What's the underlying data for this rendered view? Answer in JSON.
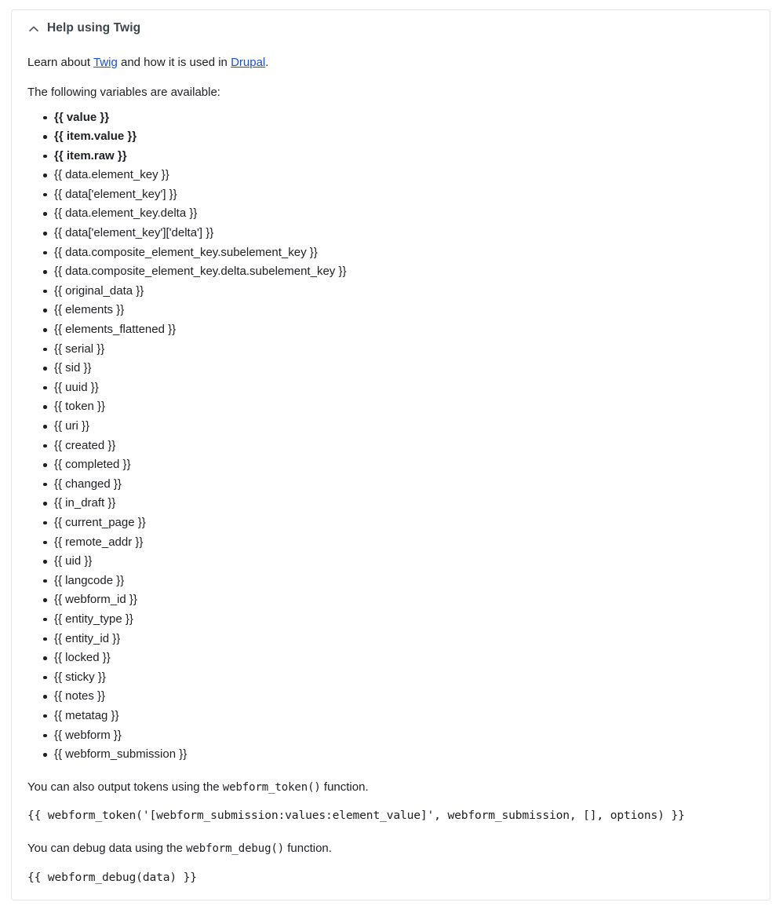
{
  "help_panel": {
    "title": "Help using Twig",
    "chevron_icon": "chevron-up-icon",
    "expanded": true,
    "intro": {
      "before_first_link": "Learn about ",
      "first_link": "Twig",
      "between_links": " and how it is used in ",
      "second_link": "Drupal",
      "after_second_link": "."
    },
    "available_heading": "The following variables are available:",
    "variables": [
      {
        "text": "{{ value }}",
        "bold": true
      },
      {
        "text": "{{ item.value }}",
        "bold": true
      },
      {
        "text": "{{ item.raw }}",
        "bold": true
      },
      {
        "text": "{{ data.element_key }}",
        "bold": false
      },
      {
        "text": "{{ data['element_key'] }}",
        "bold": false
      },
      {
        "text": "{{ data.element_key.delta }}",
        "bold": false
      },
      {
        "text": "{{ data['element_key']['delta'] }}",
        "bold": false
      },
      {
        "text": "{{ data.composite_element_key.subelement_key }}",
        "bold": false
      },
      {
        "text": "{{ data.composite_element_key.delta.subelement_key }}",
        "bold": false
      },
      {
        "text": "{{ original_data }}",
        "bold": false
      },
      {
        "text": "{{ elements }}",
        "bold": false
      },
      {
        "text": "{{ elements_flattened }}",
        "bold": false
      },
      {
        "text": "{{ serial }}",
        "bold": false
      },
      {
        "text": "{{ sid }}",
        "bold": false
      },
      {
        "text": "{{ uuid }}",
        "bold": false
      },
      {
        "text": "{{ token }}",
        "bold": false
      },
      {
        "text": "{{ uri }}",
        "bold": false
      },
      {
        "text": "{{ created }}",
        "bold": false
      },
      {
        "text": "{{ completed }}",
        "bold": false
      },
      {
        "text": "{{ changed }}",
        "bold": false
      },
      {
        "text": "{{ in_draft }}",
        "bold": false
      },
      {
        "text": "{{ current_page }}",
        "bold": false
      },
      {
        "text": "{{ remote_addr }}",
        "bold": false
      },
      {
        "text": "{{ uid }}",
        "bold": false
      },
      {
        "text": "{{ langcode }}",
        "bold": false
      },
      {
        "text": "{{ webform_id }}",
        "bold": false
      },
      {
        "text": "{{ entity_type }}",
        "bold": false
      },
      {
        "text": "{{ entity_id }}",
        "bold": false
      },
      {
        "text": "{{ locked }}",
        "bold": false
      },
      {
        "text": "{{ sticky }}",
        "bold": false
      },
      {
        "text": "{{ notes }}",
        "bold": false
      },
      {
        "text": "{{ metatag }}",
        "bold": false
      },
      {
        "text": "{{ webform }}",
        "bold": false
      },
      {
        "text": "{{ webform_submission }}",
        "bold": false
      }
    ],
    "tokens_note": {
      "before_code": "You can also output tokens using the ",
      "code": "webform_token()",
      "after_code": " function."
    },
    "tokens_example": "{{ webform_token('[webform_submission:values:element_value]', webform_submission, [], options) }}",
    "debug_note": {
      "before_code": "You can debug data using the ",
      "code": "webform_debug()",
      "after_code": " function."
    },
    "debug_example": "{{ webform_debug(data) }}"
  },
  "colors": {
    "link": "#1a4fd6",
    "text": "#202124",
    "heading": "#3e444c",
    "border": "#e4e4e4",
    "background": "#ffffff"
  }
}
